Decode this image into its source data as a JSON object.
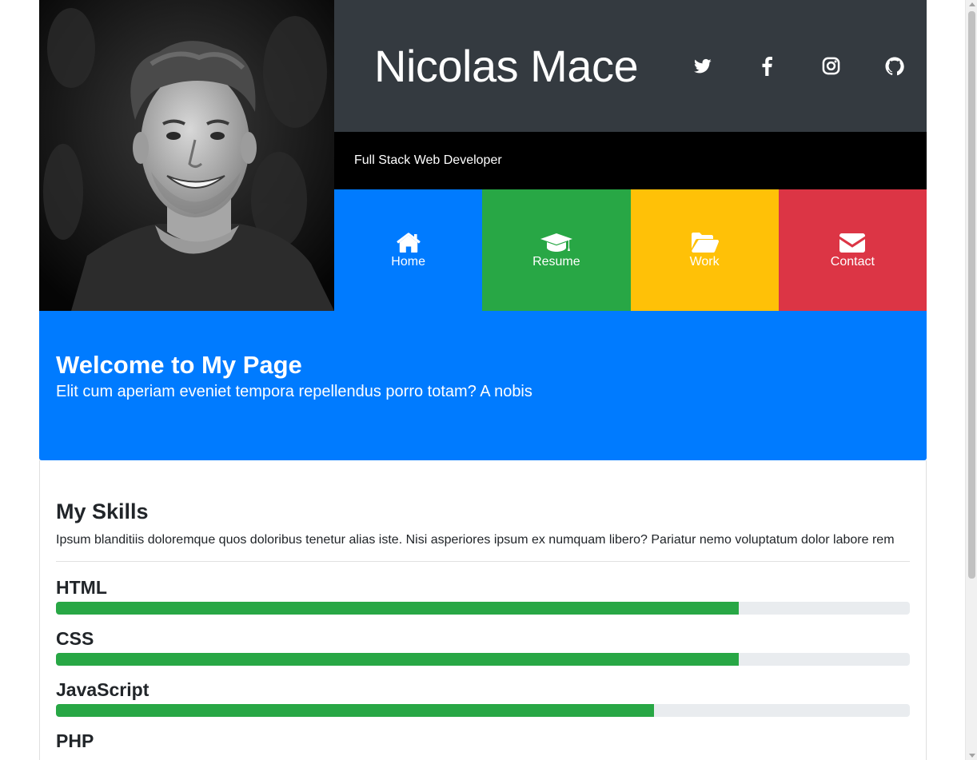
{
  "profile": {
    "name": "Nicolas Mace",
    "tagline": "Full Stack Web Developer"
  },
  "social": [
    {
      "icon": "twitter-icon"
    },
    {
      "icon": "facebook-icon"
    },
    {
      "icon": "instagram-icon"
    },
    {
      "icon": "github-icon"
    }
  ],
  "nav": [
    {
      "label": "Home",
      "icon": "home-icon",
      "color": "#007bff"
    },
    {
      "label": "Resume",
      "icon": "graduation-cap-icon",
      "color": "#28a745"
    },
    {
      "label": "Work",
      "icon": "folder-open-icon",
      "color": "#ffc107"
    },
    {
      "label": "Contact",
      "icon": "envelope-icon",
      "color": "#dc3545"
    }
  ],
  "welcome": {
    "title": "Welcome to My Page",
    "subtitle": "Elit cum aperiam eveniet tempora repellendus porro totam? A nobis"
  },
  "skills": {
    "title": "My Skills",
    "description": "Ipsum blanditiis doloremque quos doloribus tenetur alias iste. Nisi asperiores ipsum ex numquam libero? Pariatur nemo voluptatum dolor labore rem",
    "items": [
      {
        "name": "HTML",
        "level": 0.8
      },
      {
        "name": "CSS",
        "level": 0.8
      },
      {
        "name": "JavaScript",
        "level": 0.7
      },
      {
        "name": "PHP"
      }
    ]
  },
  "colors": {
    "primary": "#007bff",
    "success": "#28a745",
    "warning": "#ffc107",
    "danger": "#dc3545",
    "dark": "#343a40"
  }
}
